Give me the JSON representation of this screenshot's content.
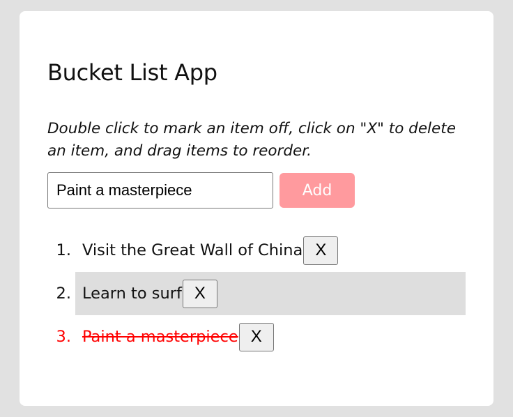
{
  "app": {
    "title": "Bucket List App",
    "instructions": "Double click to mark an item off, click on \"X\" to delete an item, and drag items to reorder."
  },
  "form": {
    "input_value": "Paint a masterpiece",
    "add_label": "Add"
  },
  "list": {
    "items": [
      {
        "number": "1.",
        "text": "Visit the Great Wall of China",
        "delete_label": "X",
        "completed": false,
        "hovered": false
      },
      {
        "number": "2.",
        "text": "Learn to surf",
        "delete_label": "X",
        "completed": false,
        "hovered": true
      },
      {
        "number": "3.",
        "text": "Paint a masterpiece",
        "delete_label": "X",
        "completed": true,
        "hovered": false
      }
    ]
  },
  "colors": {
    "background": "#e1e1e1",
    "card": "#ffffff",
    "add_button": "#ff9a9e",
    "completed_text": "#ff0000",
    "hover_row": "#dedede"
  }
}
